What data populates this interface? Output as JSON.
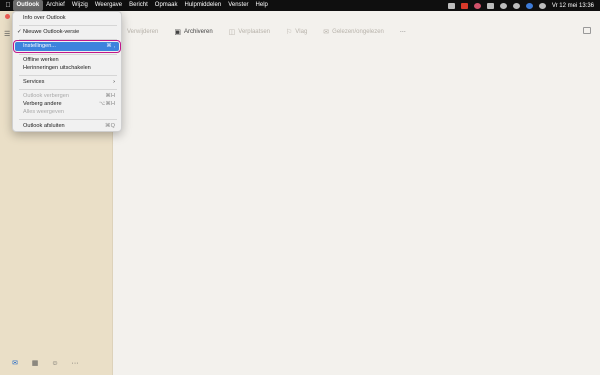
{
  "menubar": {
    "apple_icon": "apple-logo-icon",
    "items": [
      "Outlook",
      "Archief",
      "Wijzig",
      "Weergave",
      "Bericht",
      "Opmaak",
      "Hulpmiddelen",
      "Venster",
      "Help"
    ],
    "status_icons": [
      "dropbox-icon",
      "app-red-icon",
      "app-rose-icon",
      "control-center-icon",
      "wifi-icon",
      "search-icon",
      "siri-icon",
      "user-icon"
    ],
    "datetime": "Vr 12 mei  13:36"
  },
  "toolbar": {
    "delete_label": "Verwijderen",
    "archive_label": "Archiveren",
    "move_label": "Verplaatsen",
    "flag_label": "Vlag",
    "read_label": "Gelezen/ongelezen",
    "more_label": "···"
  },
  "menu": {
    "about": "Info over Outlook",
    "new_outlook": "Nieuwe Outlook-versie",
    "check_mark": "✓",
    "settings": "Instellingen...",
    "settings_shortcut": "⌘ ,",
    "offline": "Offline werken",
    "reminders_off": "Herinneringen uitschakelen",
    "services": "Services",
    "services_arrow": "›",
    "hide_outlook": "Outlook verbergen",
    "hide_outlook_shortcut": "⌘H",
    "hide_others": "Verberg andere",
    "hide_others_shortcut": "⌥⌘H",
    "show_all": "Alles weergeven",
    "quit": "Outlook afsluiten",
    "quit_shortcut": "⌘Q"
  },
  "sidebar": {
    "bottom_icons": [
      "mail-icon",
      "calendar-icon",
      "people-icon",
      "more-icon"
    ],
    "more_label": "···"
  },
  "colors": {
    "highlight": "#3d83dd",
    "highlight_outline": "#c0178a",
    "sidebar_bg": "#eadfc7"
  }
}
